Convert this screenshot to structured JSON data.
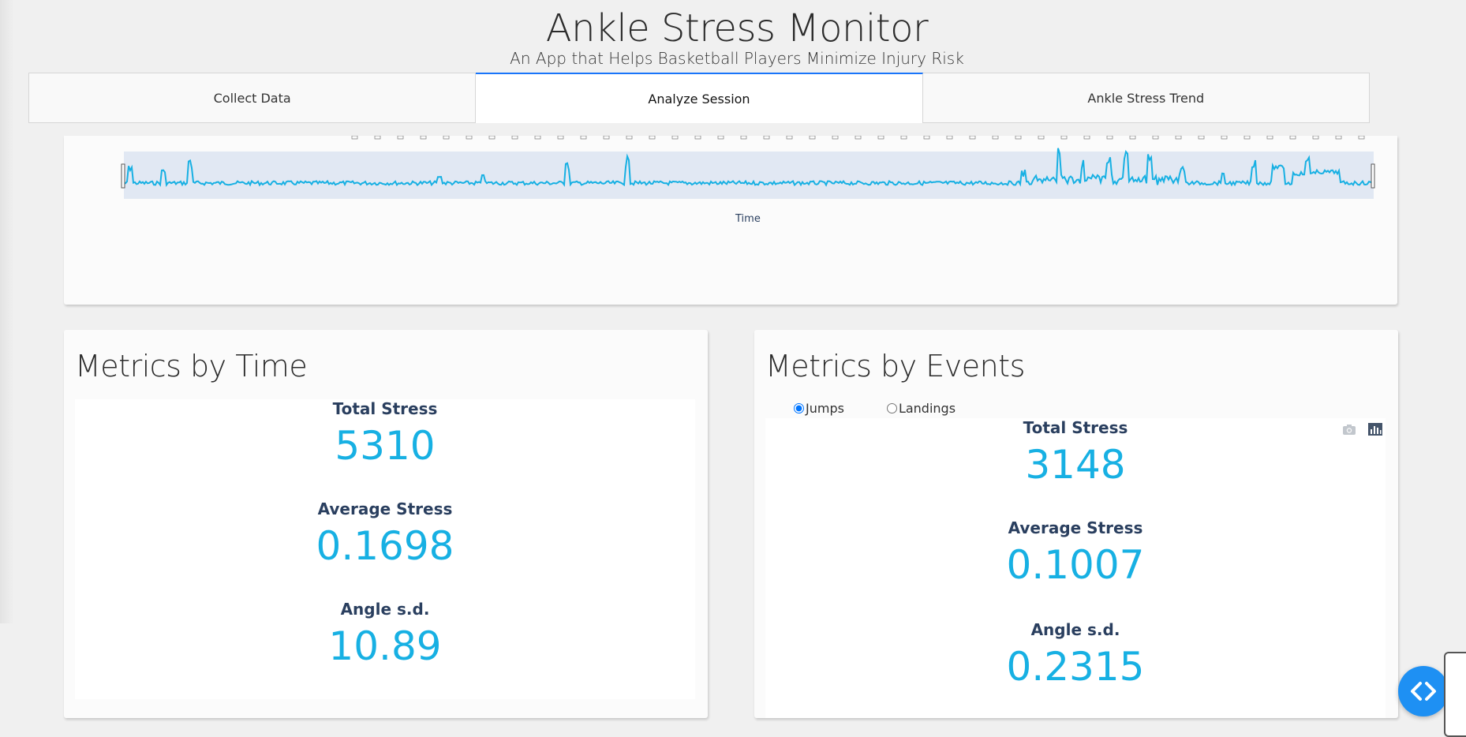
{
  "header": {
    "title": "Ankle Stress Monitor",
    "subtitle": "An App that Helps Basketball Players Minimize Injury Risk"
  },
  "tabs": [
    {
      "label": "Collect Data",
      "active": false
    },
    {
      "label": "Analyze Session",
      "active": true
    },
    {
      "label": "Ankle Stress Trend",
      "active": false
    }
  ],
  "timeline": {
    "xaxis_title": "Time",
    "line_color": "#17b0e3",
    "range_bg": "#e1e8f3"
  },
  "metrics_by_time": {
    "title": "Metrics by Time",
    "total_stress_label": "Total Stress",
    "total_stress_value": "5310",
    "avg_stress_label": "Average Stress",
    "avg_stress_value": "0.1698",
    "angle_sd_label": "Angle s.d.",
    "angle_sd_value": "10.89"
  },
  "metrics_by_events": {
    "title": "Metrics by Events",
    "options": [
      {
        "label": "Jumps",
        "selected": true
      },
      {
        "label": "Landings",
        "selected": false
      }
    ],
    "total_stress_label": "Total Stress",
    "total_stress_value": "3148",
    "avg_stress_label": "Average Stress",
    "avg_stress_value": "0.1007",
    "angle_sd_label": "Angle s.d.",
    "angle_sd_value": "0.2315",
    "modebar": [
      "camera-icon",
      "bar-chart-icon"
    ]
  },
  "colors": {
    "accent_value": "#17b0e3",
    "label_navy": "#2a3f5f",
    "active_tab": "#1975fa",
    "fab": "#1e90f3"
  }
}
